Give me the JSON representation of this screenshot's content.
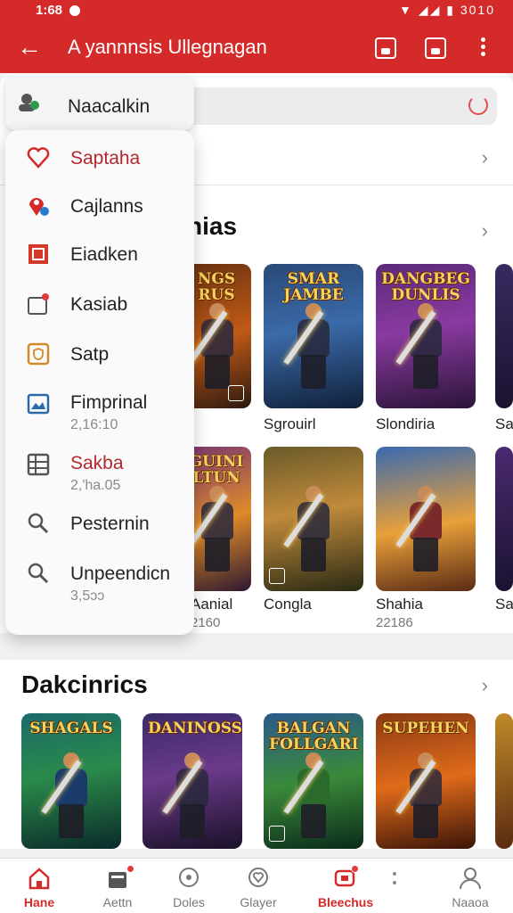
{
  "status_bar": {
    "time": "1:68",
    "right_text": "3010"
  },
  "app_bar": {
    "title": "A yannnsis Ullegnagan"
  },
  "colors": {
    "primary": "#d42a2a",
    "accent_text": "#b3282d"
  },
  "drawer": {
    "header": {
      "label": "Naacalkin",
      "icon": "user-group-icon"
    },
    "items": [
      {
        "label": "Saptaha",
        "icon": "heart-icon"
      },
      {
        "label": "Cajlanns",
        "icon": "location-pin-icon"
      },
      {
        "label": "Eiadken",
        "icon": "square-box-icon"
      },
      {
        "label": "Kasiab",
        "icon": "folder-notification-icon"
      },
      {
        "label": "Satp",
        "icon": "shield-icon"
      },
      {
        "label": "Fimprinal",
        "sub": "2,16:10",
        "icon": "image-frame-icon"
      },
      {
        "label": "Sakba",
        "sub": "2,'ha.05",
        "icon": "grid-table-icon"
      },
      {
        "label": "Pesternin",
        "icon": "search-icon"
      },
      {
        "label": "Unpeendicn",
        "sub": "3,5ɔɔ",
        "icon": "search-icon"
      }
    ]
  },
  "sections": [
    {
      "title": "nias",
      "rows": [
        [
          {
            "art_title": "NGS\nRUS",
            "name": "",
            "number": ""
          },
          {
            "art_title": "SMAR\nJAMBE",
            "name": "Sgrouirl",
            "number": ""
          },
          {
            "art_title": "DANGBEG\nDUNLIS",
            "name": "Slondiria",
            "number": ""
          },
          {
            "art_title": "",
            "name": "Sa",
            "number": ""
          }
        ],
        [
          {
            "art_title": "GUINI\nLTUN",
            "name": "Aanial",
            "number": "2160"
          },
          {
            "art_title": "",
            "name": "Congla",
            "number": ""
          },
          {
            "art_title": "",
            "name": "Shahia",
            "number": "22186"
          },
          {
            "art_title": "",
            "name": "Sa",
            "number": ""
          }
        ]
      ]
    },
    {
      "title": "Dakcinrics",
      "rows": [
        [
          {
            "art_title": "SHAGALS",
            "name": "",
            "number": ""
          },
          {
            "art_title": "DANINOSS",
            "name": "",
            "number": ""
          },
          {
            "art_title": "BALGAN FOLLGARI",
            "name": "",
            "number": ""
          },
          {
            "art_title": "SUPEHEN",
            "name": "",
            "number": ""
          }
        ]
      ]
    }
  ],
  "bottom_nav": [
    {
      "label": "Hane",
      "icon": "home-icon",
      "active": true
    },
    {
      "label": "Aettn",
      "icon": "inbox-icon",
      "active": false
    },
    {
      "label": "Doles",
      "icon": "chat-bubble-icon",
      "active": false
    },
    {
      "label": "Glayer",
      "icon": "heart-outline-icon",
      "active": false
    },
    {
      "label": "Bleechus",
      "icon": "gamepad-icon",
      "active": true
    },
    {
      "label": "",
      "icon": "more-icon",
      "active": false
    },
    {
      "label": "Naaoa",
      "icon": "profile-icon",
      "active": false
    }
  ]
}
